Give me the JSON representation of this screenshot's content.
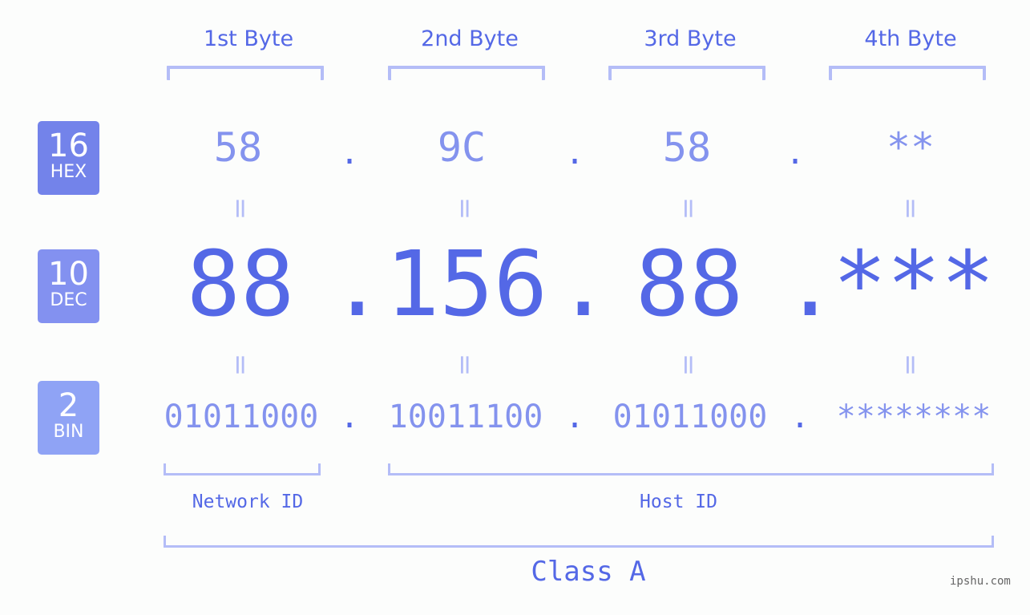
{
  "headers": [
    "1st Byte",
    "2nd Byte",
    "3rd Byte",
    "4th Byte"
  ],
  "badges": [
    {
      "num": "16",
      "label": "HEX",
      "color": "#7383ea"
    },
    {
      "num": "10",
      "label": "DEC",
      "color": "#8391f0"
    },
    {
      "num": "2",
      "label": "BIN",
      "color": "#8fa3f5"
    }
  ],
  "hex": [
    "58",
    "9C",
    "58",
    "**"
  ],
  "dec": [
    "88",
    "156",
    "88",
    "***"
  ],
  "bin": [
    "01011000",
    "10011100",
    "01011000",
    "********"
  ],
  "separator": ".",
  "equals": "=",
  "network_label": "Network ID",
  "host_label": "Host ID",
  "class_label": "Class A",
  "watermark": "ipshu.com",
  "colors": {
    "primary": "#5468e6",
    "light": "#8493ee",
    "bracket": "#b4bdf7"
  }
}
